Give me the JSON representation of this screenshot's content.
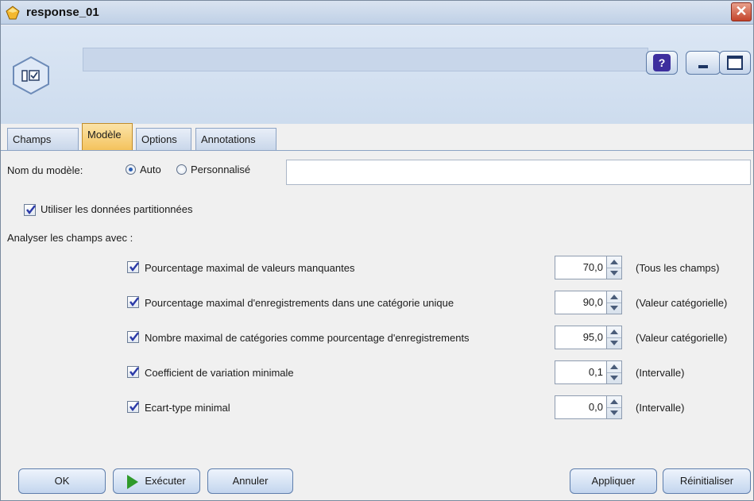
{
  "window": {
    "title": "response_01"
  },
  "header": {
    "help_label": "?"
  },
  "tabs": [
    {
      "label": "Champs"
    },
    {
      "label": "Modèle"
    },
    {
      "label": "Options"
    },
    {
      "label": "Annotations"
    }
  ],
  "active_tab": "Modèle",
  "model_name": {
    "label": "Nom du modèle:",
    "options": [
      {
        "label": "Auto",
        "selected": true
      },
      {
        "label": "Personnalisé",
        "selected": false
      }
    ],
    "custom_value": ""
  },
  "use_partitioned": {
    "label": "Utiliser les données partitionnées",
    "checked": true
  },
  "analyse": {
    "label": "Analyser les champs avec :",
    "rows": [
      {
        "label": "Pourcentage maximal de valeurs manquantes",
        "value": "70,0",
        "scope": "(Tous les champs)",
        "checked": true
      },
      {
        "label": "Pourcentage maximal d'enregistrements dans une catégorie unique",
        "value": "90,0",
        "scope": "(Valeur catégorielle)",
        "checked": true
      },
      {
        "label": "Nombre maximal de catégories comme pourcentage d'enregistrements",
        "value": "95,0",
        "scope": "(Valeur catégorielle)",
        "checked": true
      },
      {
        "label": "Coefficient de variation minimale",
        "value": "0,1",
        "scope": "(Intervalle)",
        "checked": true
      },
      {
        "label": "Ecart-type minimal",
        "value": "0,0",
        "scope": "(Intervalle)",
        "checked": true
      }
    ]
  },
  "footer": {
    "ok": "OK",
    "run": "Exécuter",
    "cancel": "Annuler",
    "apply": "Appliquer",
    "reset": "Réinitialiser"
  },
  "colors": {
    "active_tab": "#f4c35d",
    "check": "#2b3aa8",
    "run_icon": "#2f9a2a"
  }
}
